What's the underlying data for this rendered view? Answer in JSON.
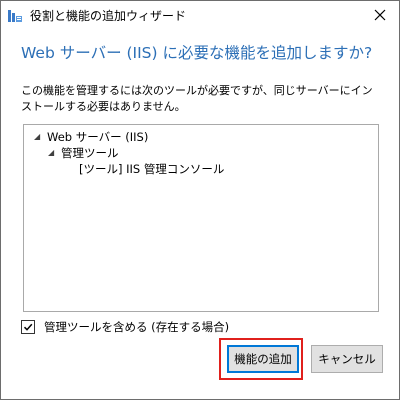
{
  "window": {
    "title": "役割と機能の追加ウィザード",
    "app_icon": "server-manager-icon",
    "close_icon": "close-icon"
  },
  "dialog": {
    "heading": "Web サーバー (IIS) に必要な機能を追加しますか?",
    "description": "この機能を管理するには次のツールが必要ですが、同じサーバーにインストールする必要はありません。",
    "tree": [
      {
        "label": "Web サーバー (IIS)",
        "expanded": true,
        "icon": "triangle-down-icon"
      },
      {
        "label": "管理ツール",
        "expanded": true,
        "icon": "triangle-down-icon"
      },
      {
        "label": "[ツール] IIS 管理コンソール"
      }
    ],
    "include_tools": {
      "label": "管理ツールを含める (存在する場合)",
      "checked": true
    },
    "buttons": {
      "add": "機能の追加",
      "cancel": "キャンセル"
    }
  },
  "colors": {
    "heading": "#2c6fb6",
    "highlight": "#e0201c",
    "default_button_border": "#0078d7"
  }
}
